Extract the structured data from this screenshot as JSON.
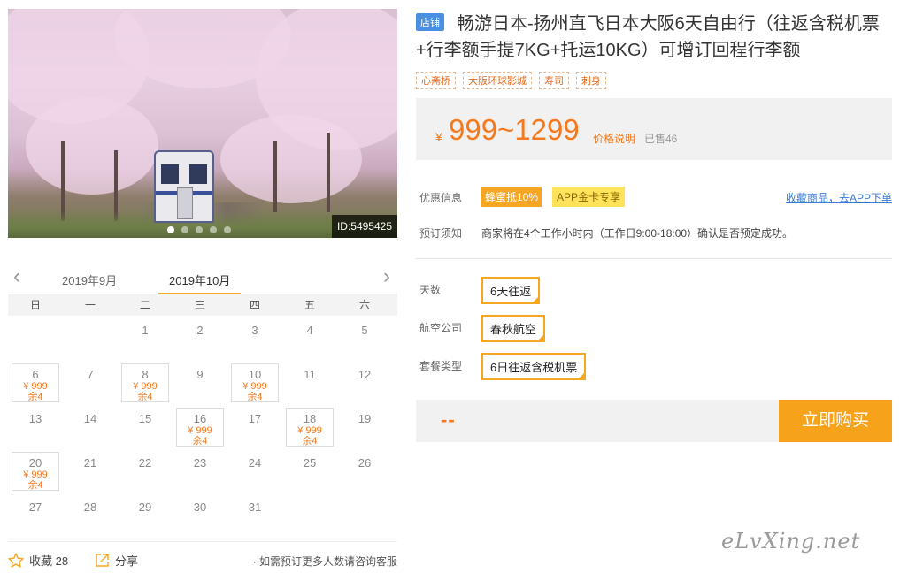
{
  "hero": {
    "id_badge": "ID:5495425",
    "slide_count": 5,
    "active_slide": 1
  },
  "calendar": {
    "prev_month": "2019年9月",
    "current_month": "2019年10月",
    "weekdays": [
      "日",
      "一",
      "二",
      "三",
      "四",
      "五",
      "六"
    ],
    "days": [
      {
        "day": ""
      },
      {
        "day": ""
      },
      {
        "day": "1"
      },
      {
        "day": "2"
      },
      {
        "day": "3"
      },
      {
        "day": "4"
      },
      {
        "day": "5"
      },
      {
        "day": "6",
        "price": "¥ 999",
        "stock": "余4"
      },
      {
        "day": "7"
      },
      {
        "day": "8",
        "price": "¥ 999",
        "stock": "余4"
      },
      {
        "day": "9"
      },
      {
        "day": "10",
        "price": "¥ 999",
        "stock": "余4"
      },
      {
        "day": "11"
      },
      {
        "day": "12"
      },
      {
        "day": "13"
      },
      {
        "day": "14"
      },
      {
        "day": "15"
      },
      {
        "day": "16",
        "price": "¥ 999",
        "stock": "余4"
      },
      {
        "day": "17"
      },
      {
        "day": "18",
        "price": "¥ 999",
        "stock": "余4"
      },
      {
        "day": "19"
      },
      {
        "day": "20",
        "price": "¥ 999",
        "stock": "余4"
      },
      {
        "day": "21"
      },
      {
        "day": "22"
      },
      {
        "day": "23"
      },
      {
        "day": "24"
      },
      {
        "day": "25"
      },
      {
        "day": "26"
      },
      {
        "day": "27"
      },
      {
        "day": "28"
      },
      {
        "day": "29"
      },
      {
        "day": "30"
      },
      {
        "day": "31"
      }
    ],
    "favorite_label": "收藏 28",
    "share_label": "分享",
    "group_note": "· 如需预订更多人数请咨询客服"
  },
  "product": {
    "shop_tag": "店铺",
    "title": "畅游日本-扬州直飞日本大阪6天自由行（往返含税机票+行李额手提7KG+托运10KG）可增订回程行李额",
    "tags": [
      "心斋桥",
      "大阪环球影城",
      "寿司",
      "刺身"
    ],
    "price_symbol": "¥",
    "price_range": "999~1299",
    "price_explain": "价格说明",
    "sold": "已售46",
    "discount_label": "优惠信息",
    "discount_1": "蜂蜜抵10%",
    "discount_2": "APP金卡专享",
    "app_link": "收藏商品，去APP下单",
    "booking_label": "预订须知",
    "booking_note": "商家将在4个工作小时内（工作日9:00-18:00）确认是否预定成功。",
    "days_label": "天数",
    "days_value": "6天往返",
    "airline_label": "航空公司",
    "airline_value": "春秋航空",
    "package_label": "套餐类型",
    "package_value": "6日往返含税机票",
    "total_placeholder": "--",
    "buy_label": "立即购买"
  },
  "watermark": "eLvXing.net",
  "colors": {
    "accent": "#f5a623",
    "price": "#f37a1f",
    "link": "#3a7bd5",
    "shop_tag": "#4a90e2"
  }
}
